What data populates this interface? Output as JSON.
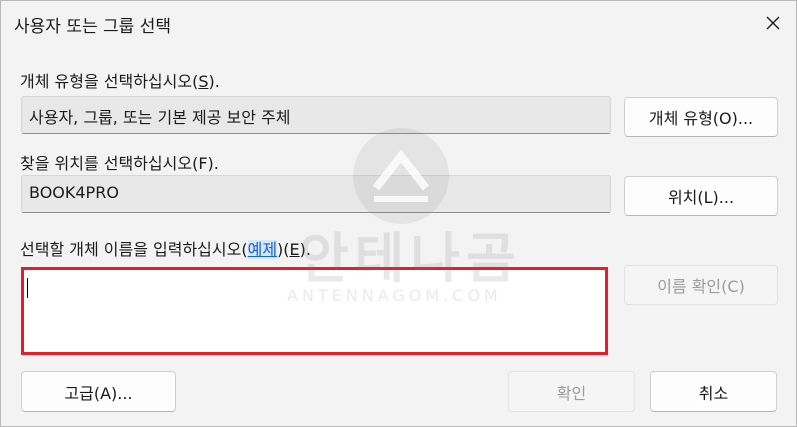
{
  "dialog": {
    "title": "사용자 또는 그룹 선택",
    "close_glyph": "✕"
  },
  "object_type": {
    "label_main": "개체 유형을 선택하십시오(",
    "label_key": "S",
    "label_end": ").",
    "value": "사용자, 그룹, 또는 기본 제공 보안 주체",
    "button": "개체 유형(O)..."
  },
  "location": {
    "label": "찾을 위치를 선택하십시오(F).",
    "value": "BOOK4PRO",
    "button": "위치(L)..."
  },
  "object_names": {
    "label_prefix": "선택할 개체 이름을 입력하십시오(",
    "examples_link": "예제",
    "label_suffix_pre": ")(",
    "label_key": "E",
    "label_suffix_end": ").",
    "value": "",
    "check_names_button": "이름 확인(C)"
  },
  "footer": {
    "advanced_button": "고급(A)...",
    "ok_button": "확인",
    "cancel_button": "취소"
  },
  "watermark": {
    "text_main": "안테나곰",
    "text_sub": "ANTENNAGOM.COM"
  },
  "colors": {
    "highlight_border": "#e61e2a",
    "link": "#1763c4"
  }
}
